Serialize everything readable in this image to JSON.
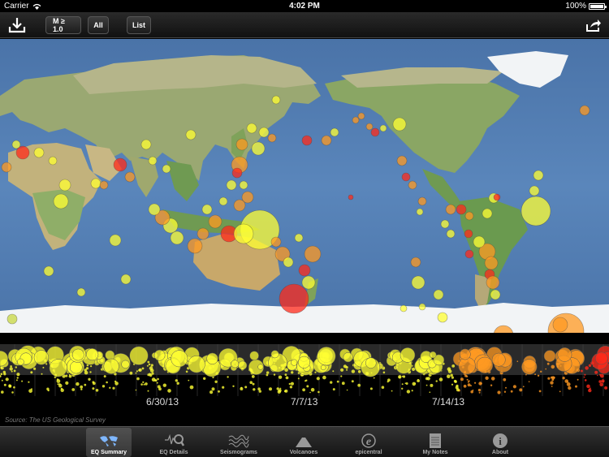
{
  "status_bar": {
    "carrier": "Carrier",
    "time": "4:02 PM",
    "battery": "100%"
  },
  "toolbar": {
    "magnitude_filter": "M ≥ 1.0",
    "period_filter": "All",
    "list_button": "List",
    "download_icon": "download-icon",
    "share_icon": "share-icon"
  },
  "map": {
    "ocean_color": "#4f78ad",
    "land_color": "#8fae68",
    "ice_color": "#f2f4f6",
    "marker_colors": [
      "#ffff33",
      "#ff9922",
      "#ff2a1a",
      "#c8d840"
    ]
  },
  "timeline": {
    "dates": [
      "6/30/13",
      "7/7/13",
      "7/14/13"
    ]
  },
  "source": "Source: The US Geological Survey",
  "tabs": [
    {
      "label": "EQ Summary",
      "icon": "world-map-icon",
      "active": true
    },
    {
      "label": "EQ Details",
      "icon": "magnifier-icon",
      "active": false
    },
    {
      "label": "Seismograms",
      "icon": "seismogram-icon",
      "active": false
    },
    {
      "label": "Volcanoes",
      "icon": "volcano-icon",
      "active": false
    },
    {
      "label": "epicentral",
      "icon": "epicentral-logo-icon",
      "active": false
    },
    {
      "label": "My Notes",
      "icon": "notepad-icon",
      "active": false
    },
    {
      "label": "About",
      "icon": "info-icon",
      "active": false
    }
  ]
}
